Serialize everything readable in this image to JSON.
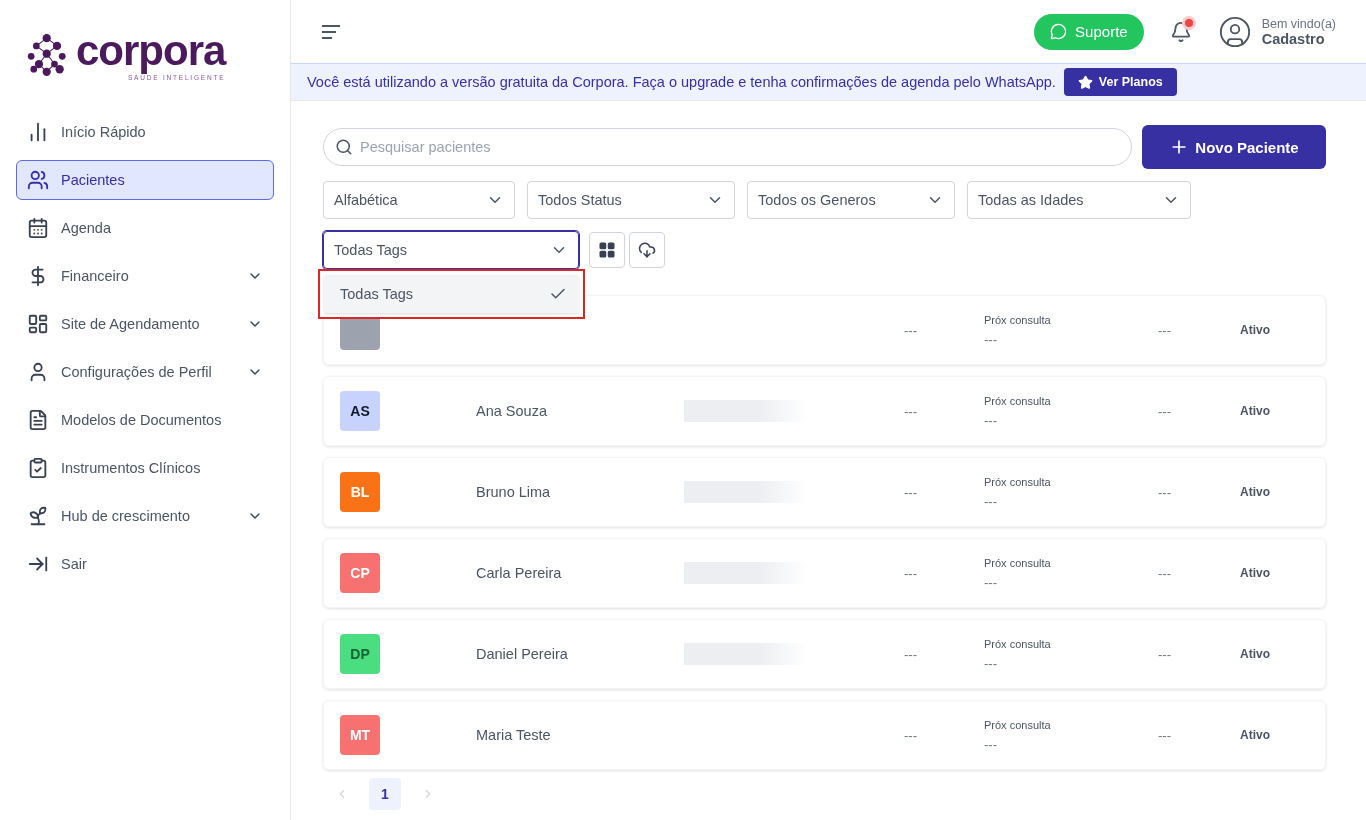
{
  "logo": {
    "name": "corpora",
    "tagline": "SAÚDE INTELIGENTE"
  },
  "sidebar": {
    "items": [
      {
        "label": "Início Rápido",
        "selected": false,
        "expandable": false
      },
      {
        "label": "Pacientes",
        "selected": true,
        "expandable": false
      },
      {
        "label": "Agenda",
        "selected": false,
        "expandable": false
      },
      {
        "label": "Financeiro",
        "selected": false,
        "expandable": true
      },
      {
        "label": "Site de Agendamento",
        "selected": false,
        "expandable": true
      },
      {
        "label": "Configurações de Perfil",
        "selected": false,
        "expandable": true
      },
      {
        "label": "Modelos de Documentos",
        "selected": false,
        "expandable": false
      },
      {
        "label": "Instrumentos Clínicos",
        "selected": false,
        "expandable": false
      },
      {
        "label": "Hub de crescimento",
        "selected": false,
        "expandable": true
      },
      {
        "label": "Sair",
        "selected": false,
        "expandable": false
      }
    ]
  },
  "header": {
    "support_button": "Suporte",
    "notification_dot": true,
    "greeting": "Bem vindo(a)",
    "user_name": "Cadastro"
  },
  "banner": {
    "text": "Você está utilizando a versão gratuita da Corpora. Faça o upgrade e tenha confirmações de agenda pelo WhatsApp.",
    "button": "Ver Planos"
  },
  "search": {
    "placeholder": "Pesquisar pacientes"
  },
  "new_patient_button": "Novo Paciente",
  "filters": [
    {
      "value": "Alfabética",
      "focused": false
    },
    {
      "value": "Todos Status",
      "focused": false
    },
    {
      "value": "Todos os Generos",
      "focused": false
    },
    {
      "value": "Todas as Idades",
      "focused": false
    },
    {
      "value": "Todas Tags",
      "focused": true
    }
  ],
  "tag_menu": {
    "options": [
      {
        "label": "Todas Tags",
        "selected": true
      }
    ]
  },
  "patients": [
    {
      "color": "#9ca3af",
      "loading": false,
      "field_1": "---",
      "next_label": "Próx consulta",
      "next_value": "---",
      "field_3": "---",
      "status": "Ativo"
    },
    {
      "initials": "AS",
      "name": "Ana Souza",
      "color": "#c7d2fe",
      "loading": true,
      "field_1": "---",
      "next_label": "Próx consulta",
      "next_value": "---",
      "field_3": "---",
      "status": "Ativo"
    },
    {
      "initials": "BL",
      "name": "Bruno Lima",
      "color": "#f97316",
      "loading": true,
      "field_1": "---",
      "next_label": "Próx consulta",
      "next_value": "---",
      "field_3": "---",
      "status": "Ativo"
    },
    {
      "initials": "CP",
      "name": "Carla Pereira",
      "color": "#f87171",
      "loading": true,
      "field_1": "---",
      "next_label": "Próx consulta",
      "next_value": "---",
      "field_3": "---",
      "status": "Ativo"
    },
    {
      "initials": "DP",
      "name": "Daniel Pereira",
      "color": "#4ade80",
      "loading": true,
      "field_1": "---",
      "next_label": "Próx consulta",
      "next_value": "---",
      "field_3": "---",
      "status": "Ativo"
    },
    {
      "initials": "MT",
      "name": "Maria Teste",
      "color": "#f87171",
      "loading": false,
      "field_1": "---",
      "next_label": "Próx consulta",
      "next_value": "---",
      "field_3": "---",
      "status": "Ativo"
    }
  ],
  "pagination": {
    "pages": [
      {
        "label": "1",
        "selected": true
      }
    ]
  }
}
